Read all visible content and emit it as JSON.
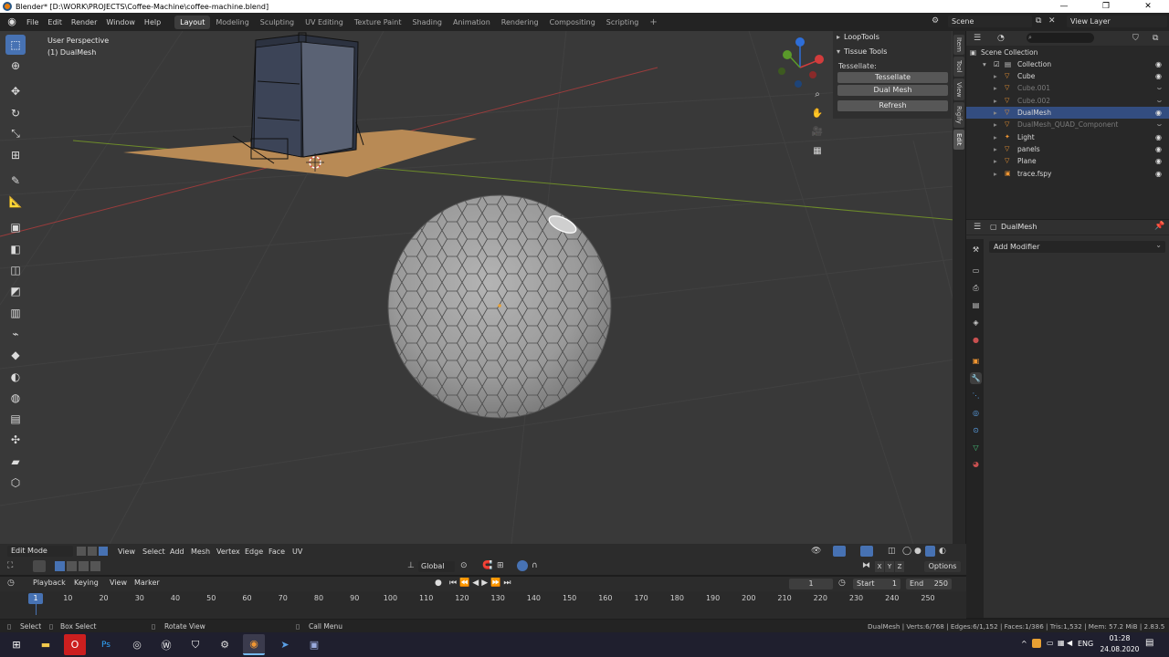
{
  "window": {
    "title": "Blender* [D:\\WORK\\PROJECTS\\Coffee-Machine\\coffee-machine.blend]",
    "controls": [
      "—",
      "❐",
      "✕"
    ]
  },
  "topbar": {
    "menus": [
      "File",
      "Edit",
      "Render",
      "Window",
      "Help"
    ],
    "workspaces": [
      "Layout",
      "Modeling",
      "Sculpting",
      "UV Editing",
      "Texture Paint",
      "Shading",
      "Animation",
      "Rendering",
      "Compositing",
      "Scripting"
    ],
    "active_workspace": "Layout",
    "scene": "Scene",
    "view_layer": "View Layer"
  },
  "viewport": {
    "perspective": "User Perspective",
    "object": "(1) DualMesh"
  },
  "npanel": {
    "loop_tools": "LoopTools",
    "tissue_tools": "Tissue Tools",
    "tessellate_label": "Tessellate:",
    "btn_tessellate": "Tessellate",
    "btn_dual_mesh": "Dual Mesh",
    "btn_refresh": "Refresh",
    "tabs": [
      "Item",
      "Tool",
      "View",
      "Rigify",
      "Edit"
    ]
  },
  "outliner": {
    "scene_collection": "Scene Collection",
    "collection": "Collection",
    "items": [
      {
        "name": "Cube",
        "dim": false,
        "selected": false
      },
      {
        "name": "Cube.001",
        "dim": true,
        "selected": false
      },
      {
        "name": "Cube.002",
        "dim": true,
        "selected": false
      },
      {
        "name": "DualMesh",
        "dim": false,
        "selected": true
      },
      {
        "name": "DualMesh_QUAD_Component",
        "dim": true,
        "selected": false
      },
      {
        "name": "Light",
        "dim": false,
        "selected": false
      },
      {
        "name": "panels",
        "dim": false,
        "selected": false
      },
      {
        "name": "Plane",
        "dim": false,
        "selected": false
      },
      {
        "name": "trace.fspy",
        "dim": false,
        "selected": false
      }
    ]
  },
  "properties": {
    "object_name": "DualMesh",
    "add_modifier": "Add Modifier"
  },
  "viewport_header": {
    "mode": "Edit Mode",
    "menus": [
      "View",
      "Select",
      "Add",
      "Mesh",
      "Vertex",
      "Edge",
      "Face",
      "UV"
    ],
    "orientation": "Global",
    "axes": [
      "X",
      "Y",
      "Z"
    ],
    "options": "Options"
  },
  "timeline": {
    "menus": [
      "Playback",
      "Keying",
      "View",
      "Marker"
    ],
    "current_frame": "1",
    "start_label": "Start",
    "start": "1",
    "end_label": "End",
    "end": "250",
    "ticks": [
      "10",
      "20",
      "30",
      "40",
      "50",
      "60",
      "70",
      "80",
      "90",
      "100",
      "110",
      "120",
      "130",
      "140",
      "150",
      "160",
      "170",
      "180",
      "190",
      "200",
      "210",
      "220",
      "230",
      "240",
      "250"
    ]
  },
  "statusbar": {
    "select": "Select",
    "box_select": "Box Select",
    "rotate_view": "Rotate View",
    "call_menu": "Call Menu",
    "stats": "DualMesh | Verts:6/768 | Edges:6/1,152 | Faces:1/386 | Tris:1,532 | Mem: 57.2 MiB | 2.83.5"
  },
  "taskbar": {
    "language": "ENG",
    "time": "01:28",
    "date": "24.08.2020"
  },
  "colors": {
    "accent": "#4772b3",
    "selection": "#334d80",
    "object_orange": "#f09632",
    "grid_x_red": "#9b3c3c",
    "grid_y_green": "#6e8c2a"
  }
}
